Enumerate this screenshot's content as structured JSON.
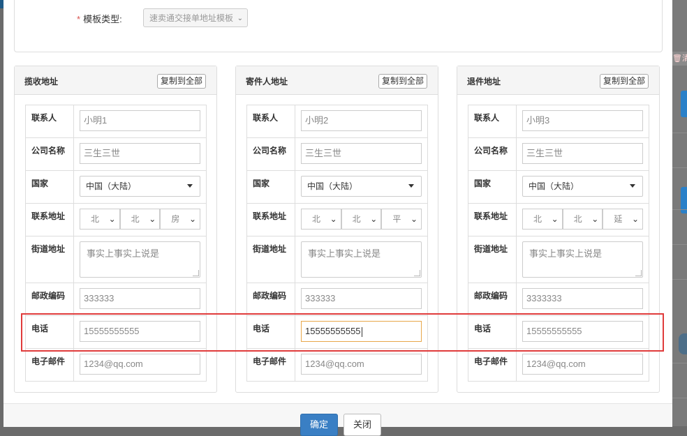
{
  "template": {
    "label": "模板类型:",
    "required_mark": "*",
    "selected": "速卖通交接单地址模板"
  },
  "panels": [
    {
      "title": "揽收地址",
      "copy_label": "复制到全部",
      "labels": {
        "contact": "联系人",
        "company": "公司名称",
        "country": "国家",
        "address": "联系地址",
        "street": "街道地址",
        "postcode": "邮政编码",
        "phone": "电话",
        "email": "电子邮件"
      },
      "contact": "小明1",
      "company": "三生三世",
      "country": "中国（大陆）",
      "region": [
        "北",
        "北",
        "房"
      ],
      "street": "事实上事实上说是",
      "postcode": "333333",
      "phone": "15555555555",
      "email": "1234@qq.com"
    },
    {
      "title": "寄件人地址",
      "copy_label": "复制到全部",
      "labels": {
        "contact": "联系人",
        "company": "公司名称",
        "country": "国家",
        "address": "联系地址",
        "street": "街道地址",
        "postcode": "邮政编码",
        "phone": "电话",
        "email": "电子邮件"
      },
      "contact": "小明2",
      "company": "三生三世",
      "country": "中国（大陆）",
      "region": [
        "北",
        "北",
        "平"
      ],
      "street": "事实上事实上说是",
      "postcode": "333333",
      "phone": "15555555555",
      "email": "1234@qq.com"
    },
    {
      "title": "退件地址",
      "copy_label": "复制到全部",
      "labels": {
        "contact": "联系人",
        "company": "公司名称",
        "country": "国家",
        "address": "联系地址",
        "street": "街道地址",
        "postcode": "邮政编码",
        "phone": "电话",
        "email": "电子邮件"
      },
      "contact": "小明3",
      "company": "三生三世",
      "country": "中国（大陆）",
      "region": [
        "北",
        "北",
        "延"
      ],
      "street": "事实上事实上说是",
      "postcode": "3333333",
      "phone": "15555555555",
      "email": "1234@qq.com"
    }
  ],
  "footer": {
    "confirm": "确定",
    "close": "关闭"
  },
  "backdrop": {
    "clear_label": "清"
  },
  "colors": {
    "highlight": "#e03b3b",
    "primary": "#3a7fc4",
    "required": "#d9534f",
    "focus": "#e8a74a"
  }
}
